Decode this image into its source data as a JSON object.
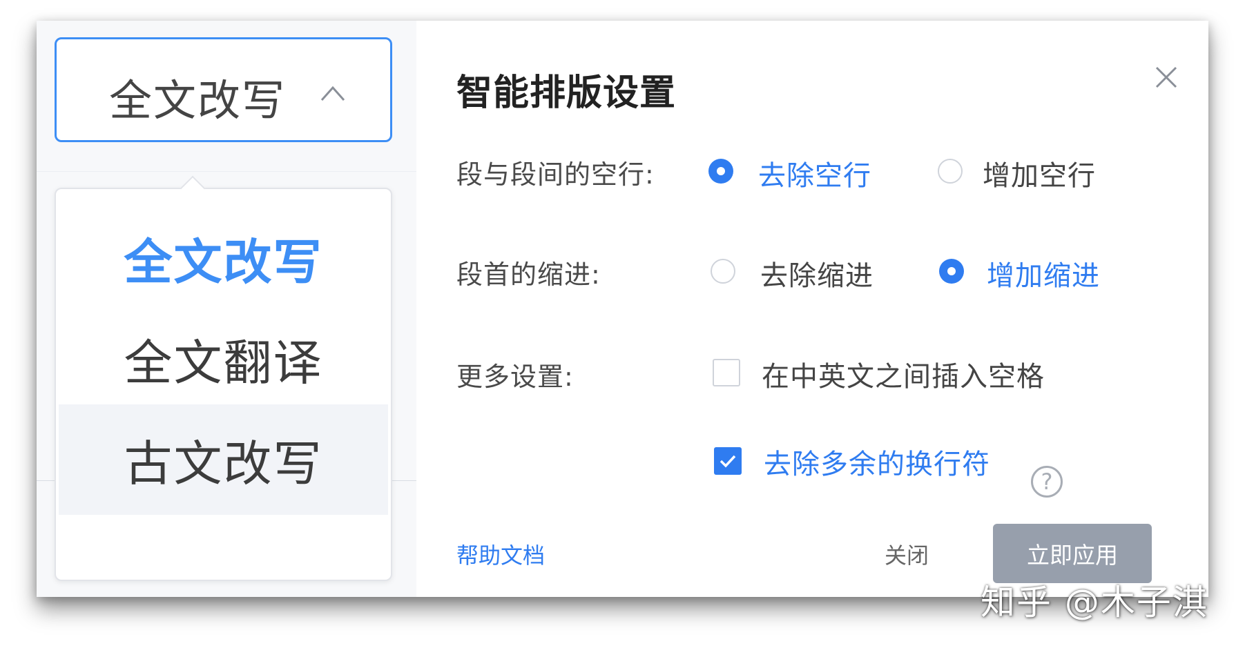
{
  "mode_select": {
    "label": "全文改写",
    "icon": "chevron-up-icon"
  },
  "dropdown": {
    "items": [
      {
        "label": "全文改写",
        "state": "selected"
      },
      {
        "label": "全文翻译",
        "state": "normal"
      },
      {
        "label": "古文改写",
        "state": "hover"
      }
    ]
  },
  "panel": {
    "title": "智能排版设置",
    "close_icon": "close-icon",
    "paragraph_spacing": {
      "label": "段与段间的空行:",
      "options": [
        {
          "label": "去除空行",
          "checked": true
        },
        {
          "label": "增加空行",
          "checked": false
        }
      ]
    },
    "indent": {
      "label": "段首的缩进:",
      "options": [
        {
          "label": "去除缩进",
          "checked": false
        },
        {
          "label": "增加缩进",
          "checked": true
        }
      ]
    },
    "more": {
      "label": "更多设置:",
      "options": [
        {
          "label": "在中英文之间插入空格",
          "checked": false
        },
        {
          "label": "去除多余的换行符",
          "checked": true
        }
      ],
      "help_glyph": "?"
    }
  },
  "footer": {
    "help_link": "帮助文档",
    "close_label": "关闭",
    "apply_label": "立即应用"
  },
  "watermark": "知乎 @木子淇",
  "colors": {
    "accent": "#2f7cf0",
    "dropdown_accent": "#3d8ef5",
    "apply_bg": "#979fac"
  }
}
